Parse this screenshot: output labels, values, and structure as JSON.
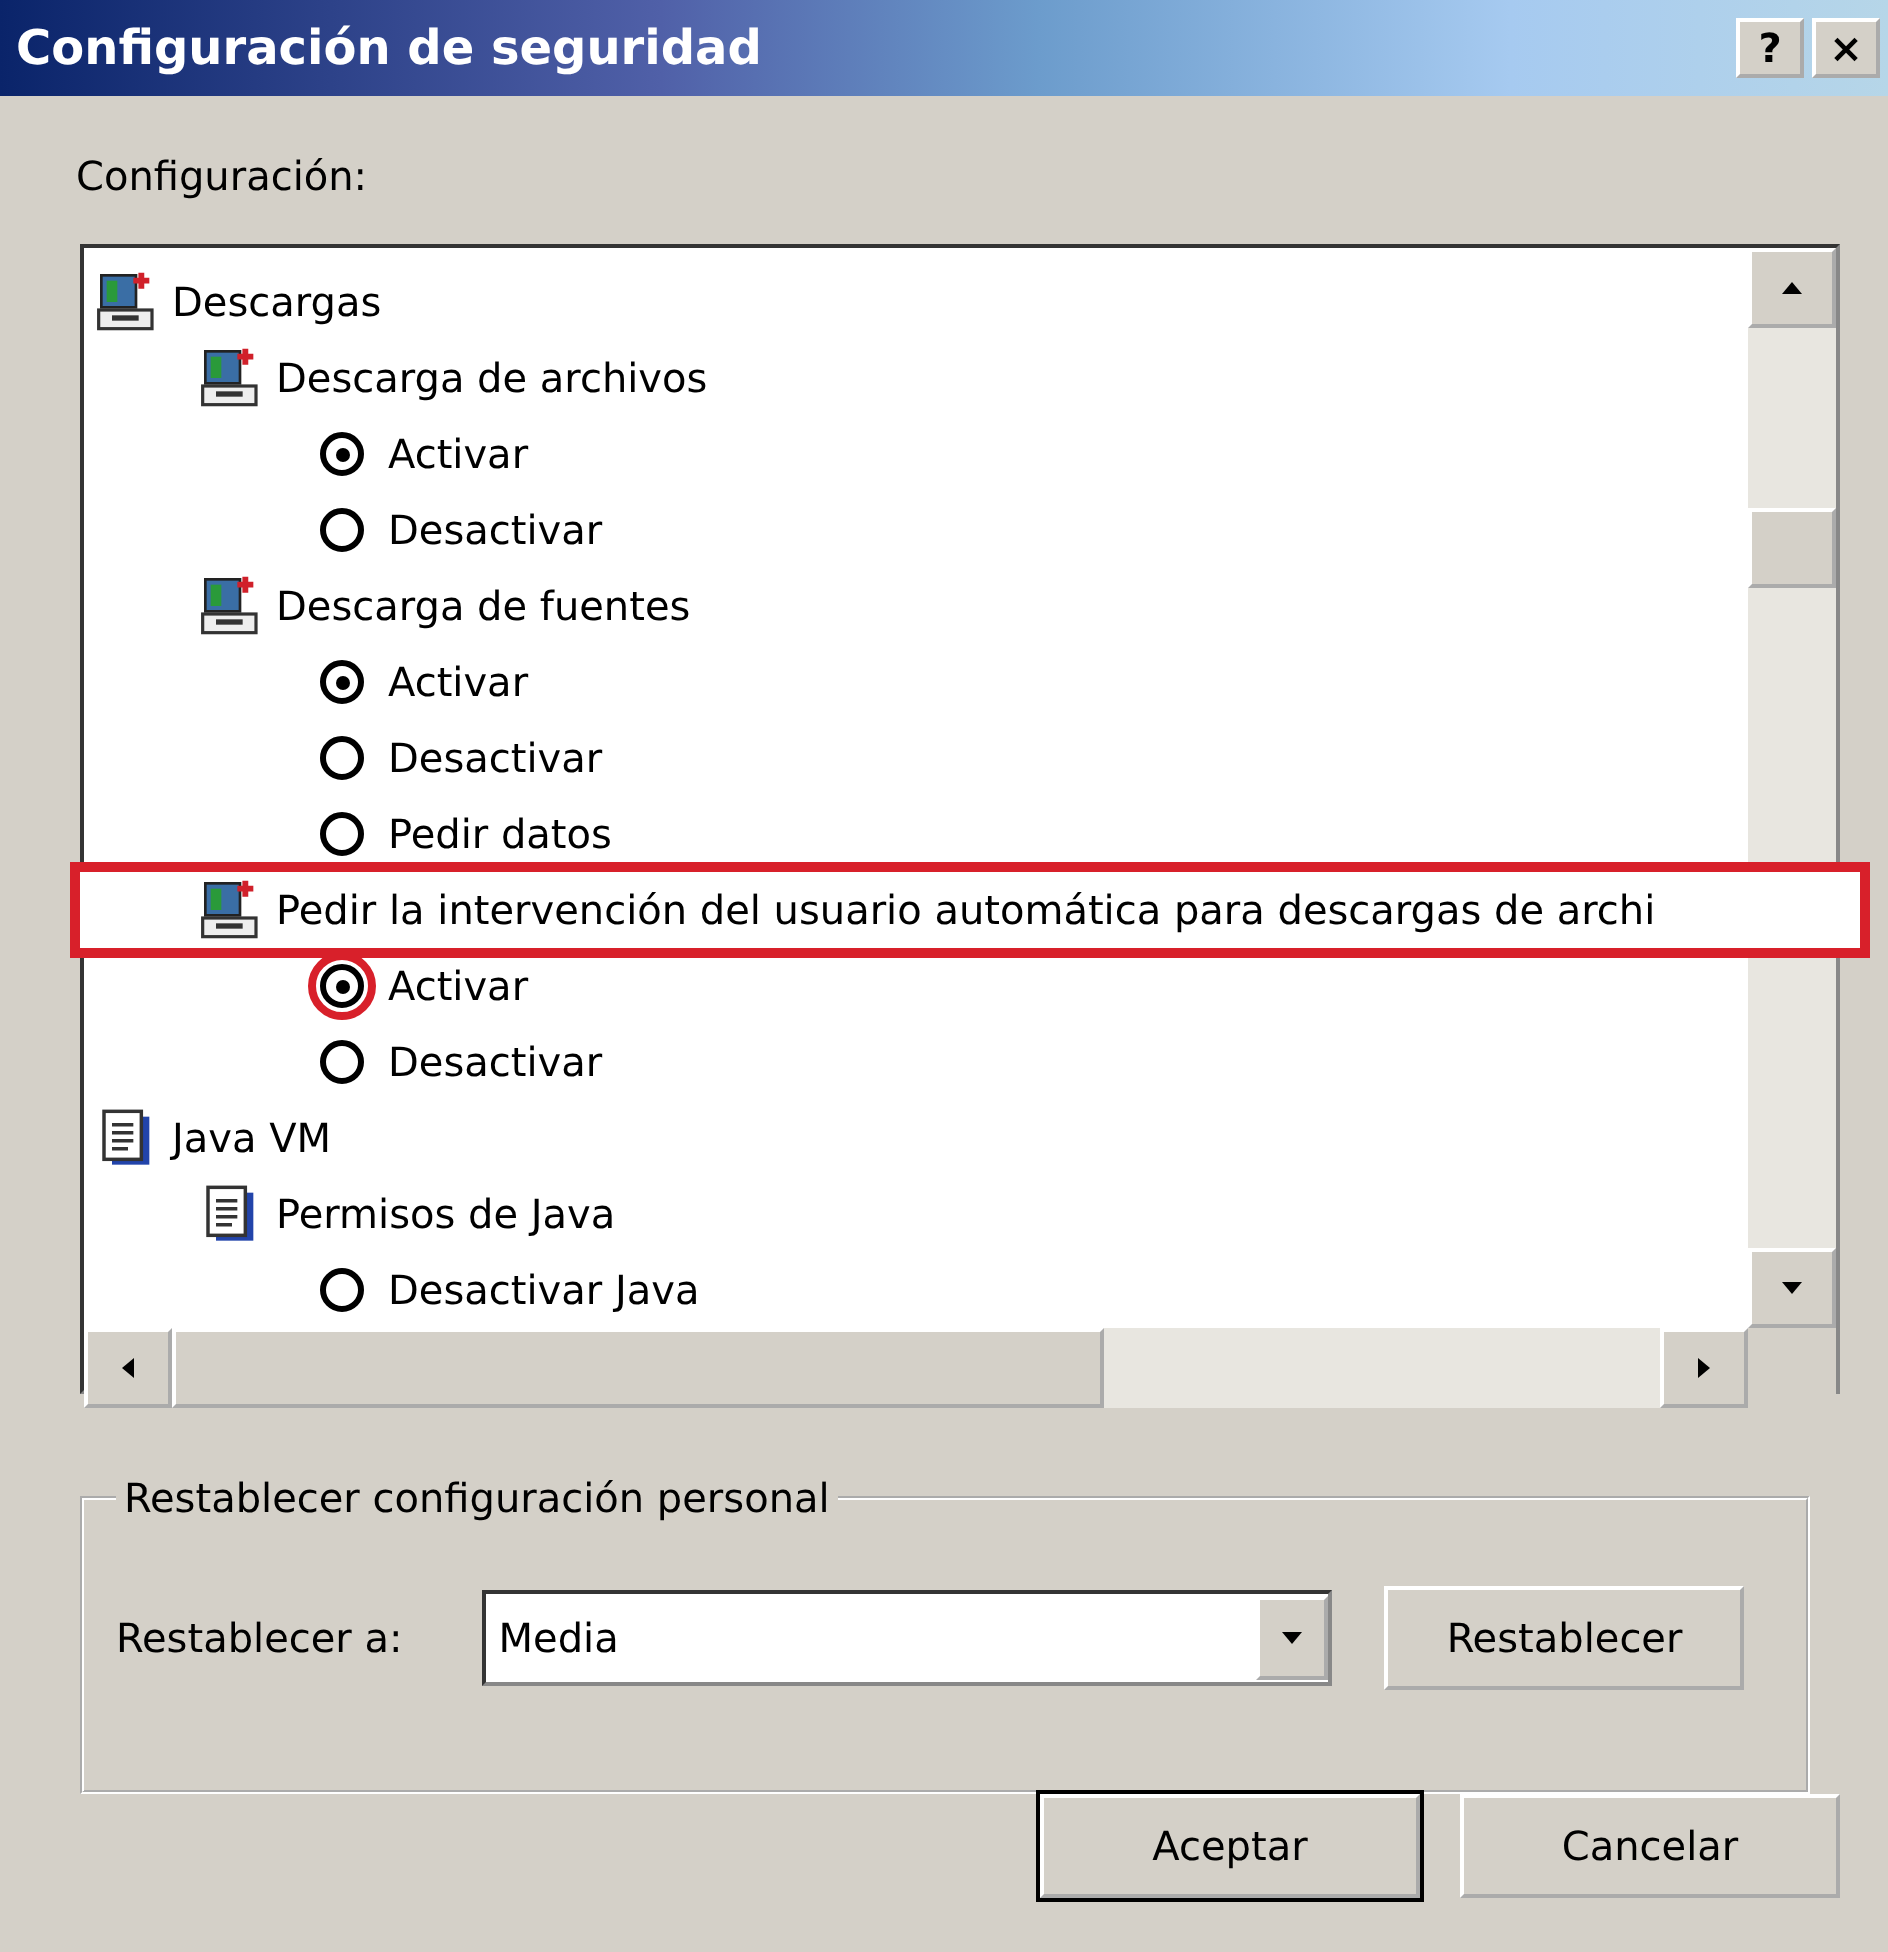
{
  "window": {
    "title": "Configuración de seguridad",
    "title_buttons": [
      "?",
      "×"
    ]
  },
  "settings_label": "Configuración:",
  "tree": [
    {
      "kind": "download",
      "label": "Descargas",
      "highlighted": false,
      "children": [
        {
          "kind": "download",
          "label": "Descarga de archivos",
          "highlighted": false,
          "children": [
            {
              "kind": "radio",
              "label": "Activar",
              "selected": true,
              "highlighted": false
            },
            {
              "kind": "radio",
              "label": "Desactivar",
              "selected": false,
              "highlighted": false
            }
          ]
        },
        {
          "kind": "download",
          "label": "Descarga de fuentes",
          "highlighted": false,
          "children": [
            {
              "kind": "radio",
              "label": "Activar",
              "selected": true,
              "highlighted": false
            },
            {
              "kind": "radio",
              "label": "Desactivar",
              "selected": false,
              "highlighted": false
            },
            {
              "kind": "radio",
              "label": "Pedir datos",
              "selected": false,
              "highlighted": false
            }
          ]
        },
        {
          "kind": "download",
          "label": "Pedir la intervención del usuario automática para descargas de archi",
          "highlighted": true,
          "children": [
            {
              "kind": "radio",
              "label": "Activar",
              "selected": true,
              "highlighted": true
            },
            {
              "kind": "radio",
              "label": "Desactivar",
              "selected": false,
              "highlighted": false
            }
          ]
        }
      ]
    },
    {
      "kind": "document",
      "label": "Java VM",
      "highlighted": false,
      "children": [
        {
          "kind": "document",
          "label": "Permisos de Java",
          "highlighted": false,
          "children": [
            {
              "kind": "radio",
              "label": "Desactivar Java",
              "selected": false,
              "highlighted": false
            }
          ]
        }
      ]
    }
  ],
  "reset_group": {
    "title": "Restablecer configuración personal",
    "label": "Restablecer a:",
    "value": "Media",
    "button": "Restablecer"
  },
  "buttons": [
    "Aceptar",
    "Cancelar"
  ]
}
